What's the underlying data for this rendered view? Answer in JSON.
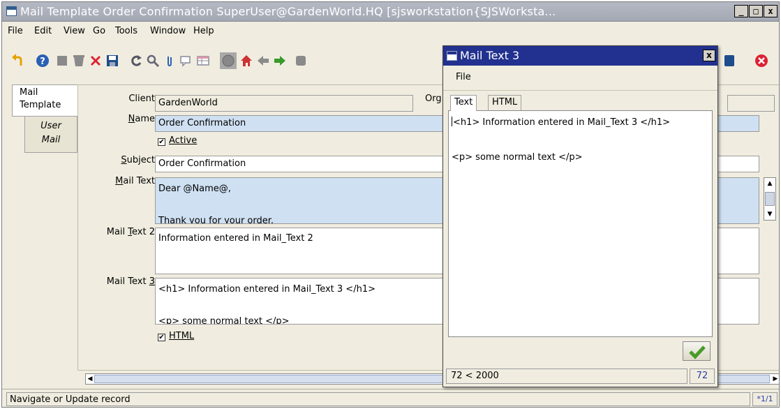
{
  "window": {
    "title": "Mail Template  Order Confirmation  SuperUser@GardenWorld.HQ [sjsworkstation{SJSWorksta...",
    "minimize": "_",
    "maximize": "□",
    "close": "x"
  },
  "menu": {
    "file": "File",
    "edit": "Edit",
    "view": "View",
    "go": "Go",
    "tools": "Tools",
    "window": "Window",
    "help": "Help"
  },
  "toolbar": {
    "icons": [
      "undo-icon",
      "help-icon",
      "new-record-icon",
      "delete-icon",
      "delete-x-icon",
      "save-icon",
      "refresh-icon",
      "find-icon",
      "attachment-icon",
      "chat-icon",
      "grid-icon",
      "history-icon",
      "home-icon",
      "back-icon",
      "forward-icon",
      "lookup-icon",
      "exit-icon"
    ]
  },
  "tabs": {
    "mail_template": "Mail\nTemplate",
    "user_mail": "User\nMail"
  },
  "form": {
    "client_label": "Client",
    "client_value": "GardenWorld",
    "org_label": "Org",
    "name_label": "Name",
    "name_value": "Order Confirmation",
    "active_label": "Active",
    "subject_label": "Subject",
    "subject_value": "Order Confirmation",
    "mailtext_label": "Mail Text",
    "mailtext_value": "Dear @Name@,\n\nThank you for your order.",
    "mailtext2_label": "Mail Text 2",
    "mailtext2_value": "Information entered in Mail_Text 2",
    "mailtext3_label": "Mail Text 3",
    "mailtext3_value": "<h1> Information entered in Mail_Text 3 </h1>\n\n<p> some normal text </p>",
    "html_label": "HTML"
  },
  "status": {
    "text": "Navigate or Update record",
    "record": "*1/1"
  },
  "dialog": {
    "title": "Mail Text 3",
    "close": "x",
    "menu_file": "File",
    "tab_text": "Text",
    "tab_html": "HTML",
    "content": "<h1> Information entered in Mail_Text 3 </h1>\n\n<p> some normal text </p>",
    "length_info": "72 < 2000",
    "length": "72"
  },
  "colors": {
    "title_bar": "#a4a8b3",
    "dialog_title": "#22318f",
    "mandatory_field": "#cfe0f2",
    "background": "#f0ede0"
  }
}
